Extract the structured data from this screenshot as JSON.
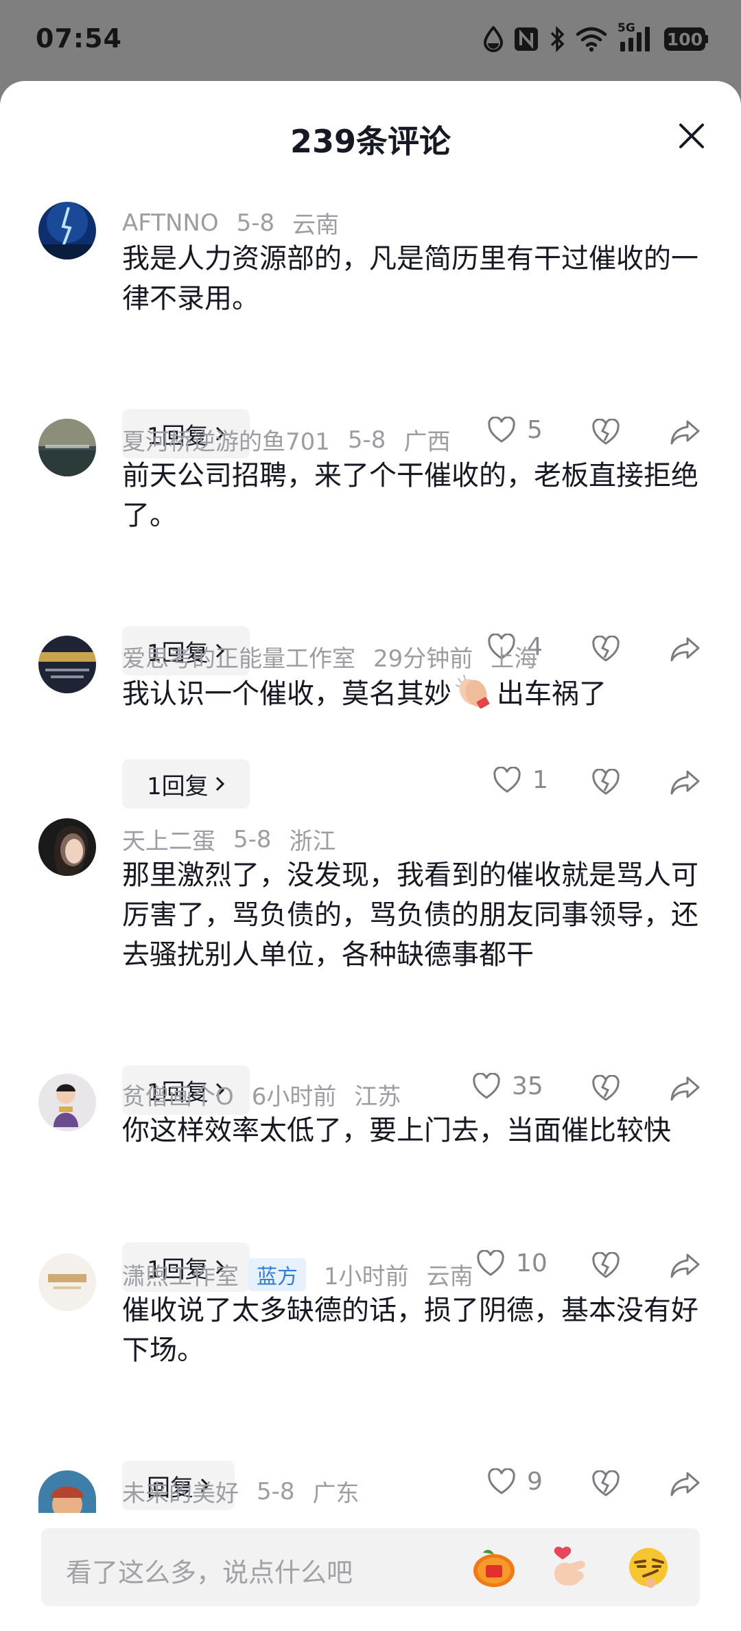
{
  "status_bar": {
    "time": "07:54",
    "network": "5G",
    "battery": "100",
    "icons": [
      "water-drop-icon",
      "nfc-icon",
      "bluetooth-icon",
      "wifi-icon",
      "signal-icon",
      "battery-icon"
    ]
  },
  "sheet": {
    "title": "239条评论",
    "close_icon": "close-icon"
  },
  "comments": [
    {
      "author": "AFTNNO",
      "date": "5-8",
      "location": "云南",
      "text": "我是人力资源部的，凡是简历里有干过催收的一律不录用。",
      "reply_label": "1回复",
      "likes": "5"
    },
    {
      "author": "夏河桥逆游的鱼701",
      "date": "5-8",
      "location": "广西",
      "text": "前天公司招聘，来了个干催收的，老板直接拒绝了。",
      "reply_label": "1回复",
      "likes": "4"
    },
    {
      "author": "爱思考的正能量工作室",
      "date": "29分钟前",
      "location": "上海",
      "text_before": "我认识一个催收，莫名其妙",
      "emoji": "clapping-hands-emoji",
      "text_after": "出车祸了",
      "reply_label": "1回复",
      "likes": "1"
    },
    {
      "author": "天上二蛋",
      "date": "5-8",
      "location": "浙江",
      "text": "那里激烈了，没发现，我看到的催收就是骂人可厉害了，骂负债的，骂负债的朋友同事领导，还去骚扰别人单位，各种缺德事都干",
      "reply_label": "1回复",
      "likes": "35"
    },
    {
      "author": "贫僧画个O",
      "date": "6小时前",
      "location": "江苏",
      "text": "你这样效率太低了，要上门去，当面催比较快",
      "reply_label": "1回复",
      "likes": "10"
    },
    {
      "author": "潇煦工作室",
      "badge": "蓝方",
      "date": "1小时前",
      "location": "云南",
      "text": "催收说了太多缺德的话，损了阴德，基本没有好下场。",
      "reply_label": "回复",
      "likes": "9"
    },
    {
      "author": "未来的美好",
      "date": "5-8",
      "location": "广东"
    }
  ],
  "input": {
    "placeholder": "看了这么多，说点什么吧",
    "quick_emojis": [
      "tangerine-emoji",
      "finger-heart-emoji",
      "smirk-emoji"
    ]
  },
  "colors": {
    "accent_badge_bg": "#e6f1fc",
    "accent_badge_text": "#2f7dd6",
    "meta_gray": "#9b9da2"
  }
}
